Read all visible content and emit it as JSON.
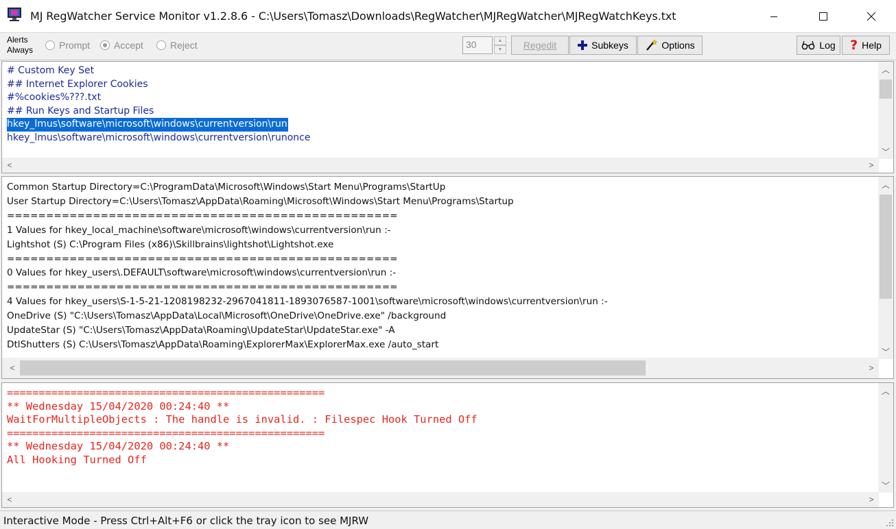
{
  "window": {
    "title": "MJ RegWatcher Service Monitor v1.2.8.6 - C:\\Users\\Tomasz\\Downloads\\RegWatcher\\MJRegWatcher\\MJRegWatchKeys.txt",
    "icon": "monitor-app-icon"
  },
  "toolbar": {
    "alerts_label_1": "Alerts",
    "alerts_label_2": "Always",
    "radio_prompt": "Prompt",
    "radio_accept": "Accept",
    "radio_reject": "Reject",
    "selected_radio": "Accept",
    "spin_value": "30",
    "regedit_label": "Regedit",
    "subkeys_label": "Subkeys",
    "options_label": "Options",
    "log_label": "Log",
    "help_label": "Help"
  },
  "keys_panel": {
    "lines": [
      "# Custom Key Set",
      "## Internet Explorer Cookies",
      "#%cookies%???.txt",
      "## Run Keys and Startup Files",
      "hkey_lmus\\software\\microsoft\\windows\\currentversion\\run",
      "hkey_lmus\\software\\microsoft\\windows\\currentversion\\runonce"
    ],
    "selected_index": 4
  },
  "values_panel": {
    "lines": [
      "Common Startup Directory=C:\\ProgramData\\Microsoft\\Windows\\Start Menu\\Programs\\StartUp",
      "User Startup Directory=C:\\Users\\Tomasz\\AppData\\Roaming\\Microsoft\\Windows\\Start Menu\\Programs\\Startup",
      "==================================================",
      "1 Values for hkey_local_machine\\software\\microsoft\\windows\\currentversion\\run :-",
      "Lightshot (S) C:\\Program Files (x86)\\Skillbrains\\lightshot\\Lightshot.exe",
      "==================================================",
      "0 Values for hkey_users\\.DEFAULT\\software\\microsoft\\windows\\currentversion\\run :-",
      "==================================================",
      "4 Values for hkey_users\\S-1-5-21-1208198232-2967041811-1893076587-1001\\software\\microsoft\\windows\\currentversion\\run :-",
      "OneDrive (S) \"C:\\Users\\Tomasz\\AppData\\Local\\Microsoft\\OneDrive\\OneDrive.exe\" /background",
      "UpdateStar (S) \"C:\\Users\\Tomasz\\AppData\\Roaming\\UpdateStar\\UpdateStar.exe\" -A",
      "DtlShutters (S) C:\\Users\\Tomasz\\AppData\\Roaming\\ExplorerMax\\ExplorerMax.exe /auto_start"
    ]
  },
  "log_panel": {
    "lines": [
      "==================================================",
      "** Wednesday 15/04/2020 00:24:40 **",
      "WaitForMultipleObjects : The handle is invalid. : Filespec Hook Turned Off",
      "==================================================",
      "** Wednesday 15/04/2020 00:24:40 **",
      "All Hooking Turned Off"
    ]
  },
  "status_bar": {
    "text": "Interactive Mode - Press Ctrl+Alt+F6 or click the tray icon to see MJRW"
  },
  "colors": {
    "keys_text": "#1a2aa0",
    "selection": "#0a6cd6",
    "log_text": "#e8241c"
  }
}
